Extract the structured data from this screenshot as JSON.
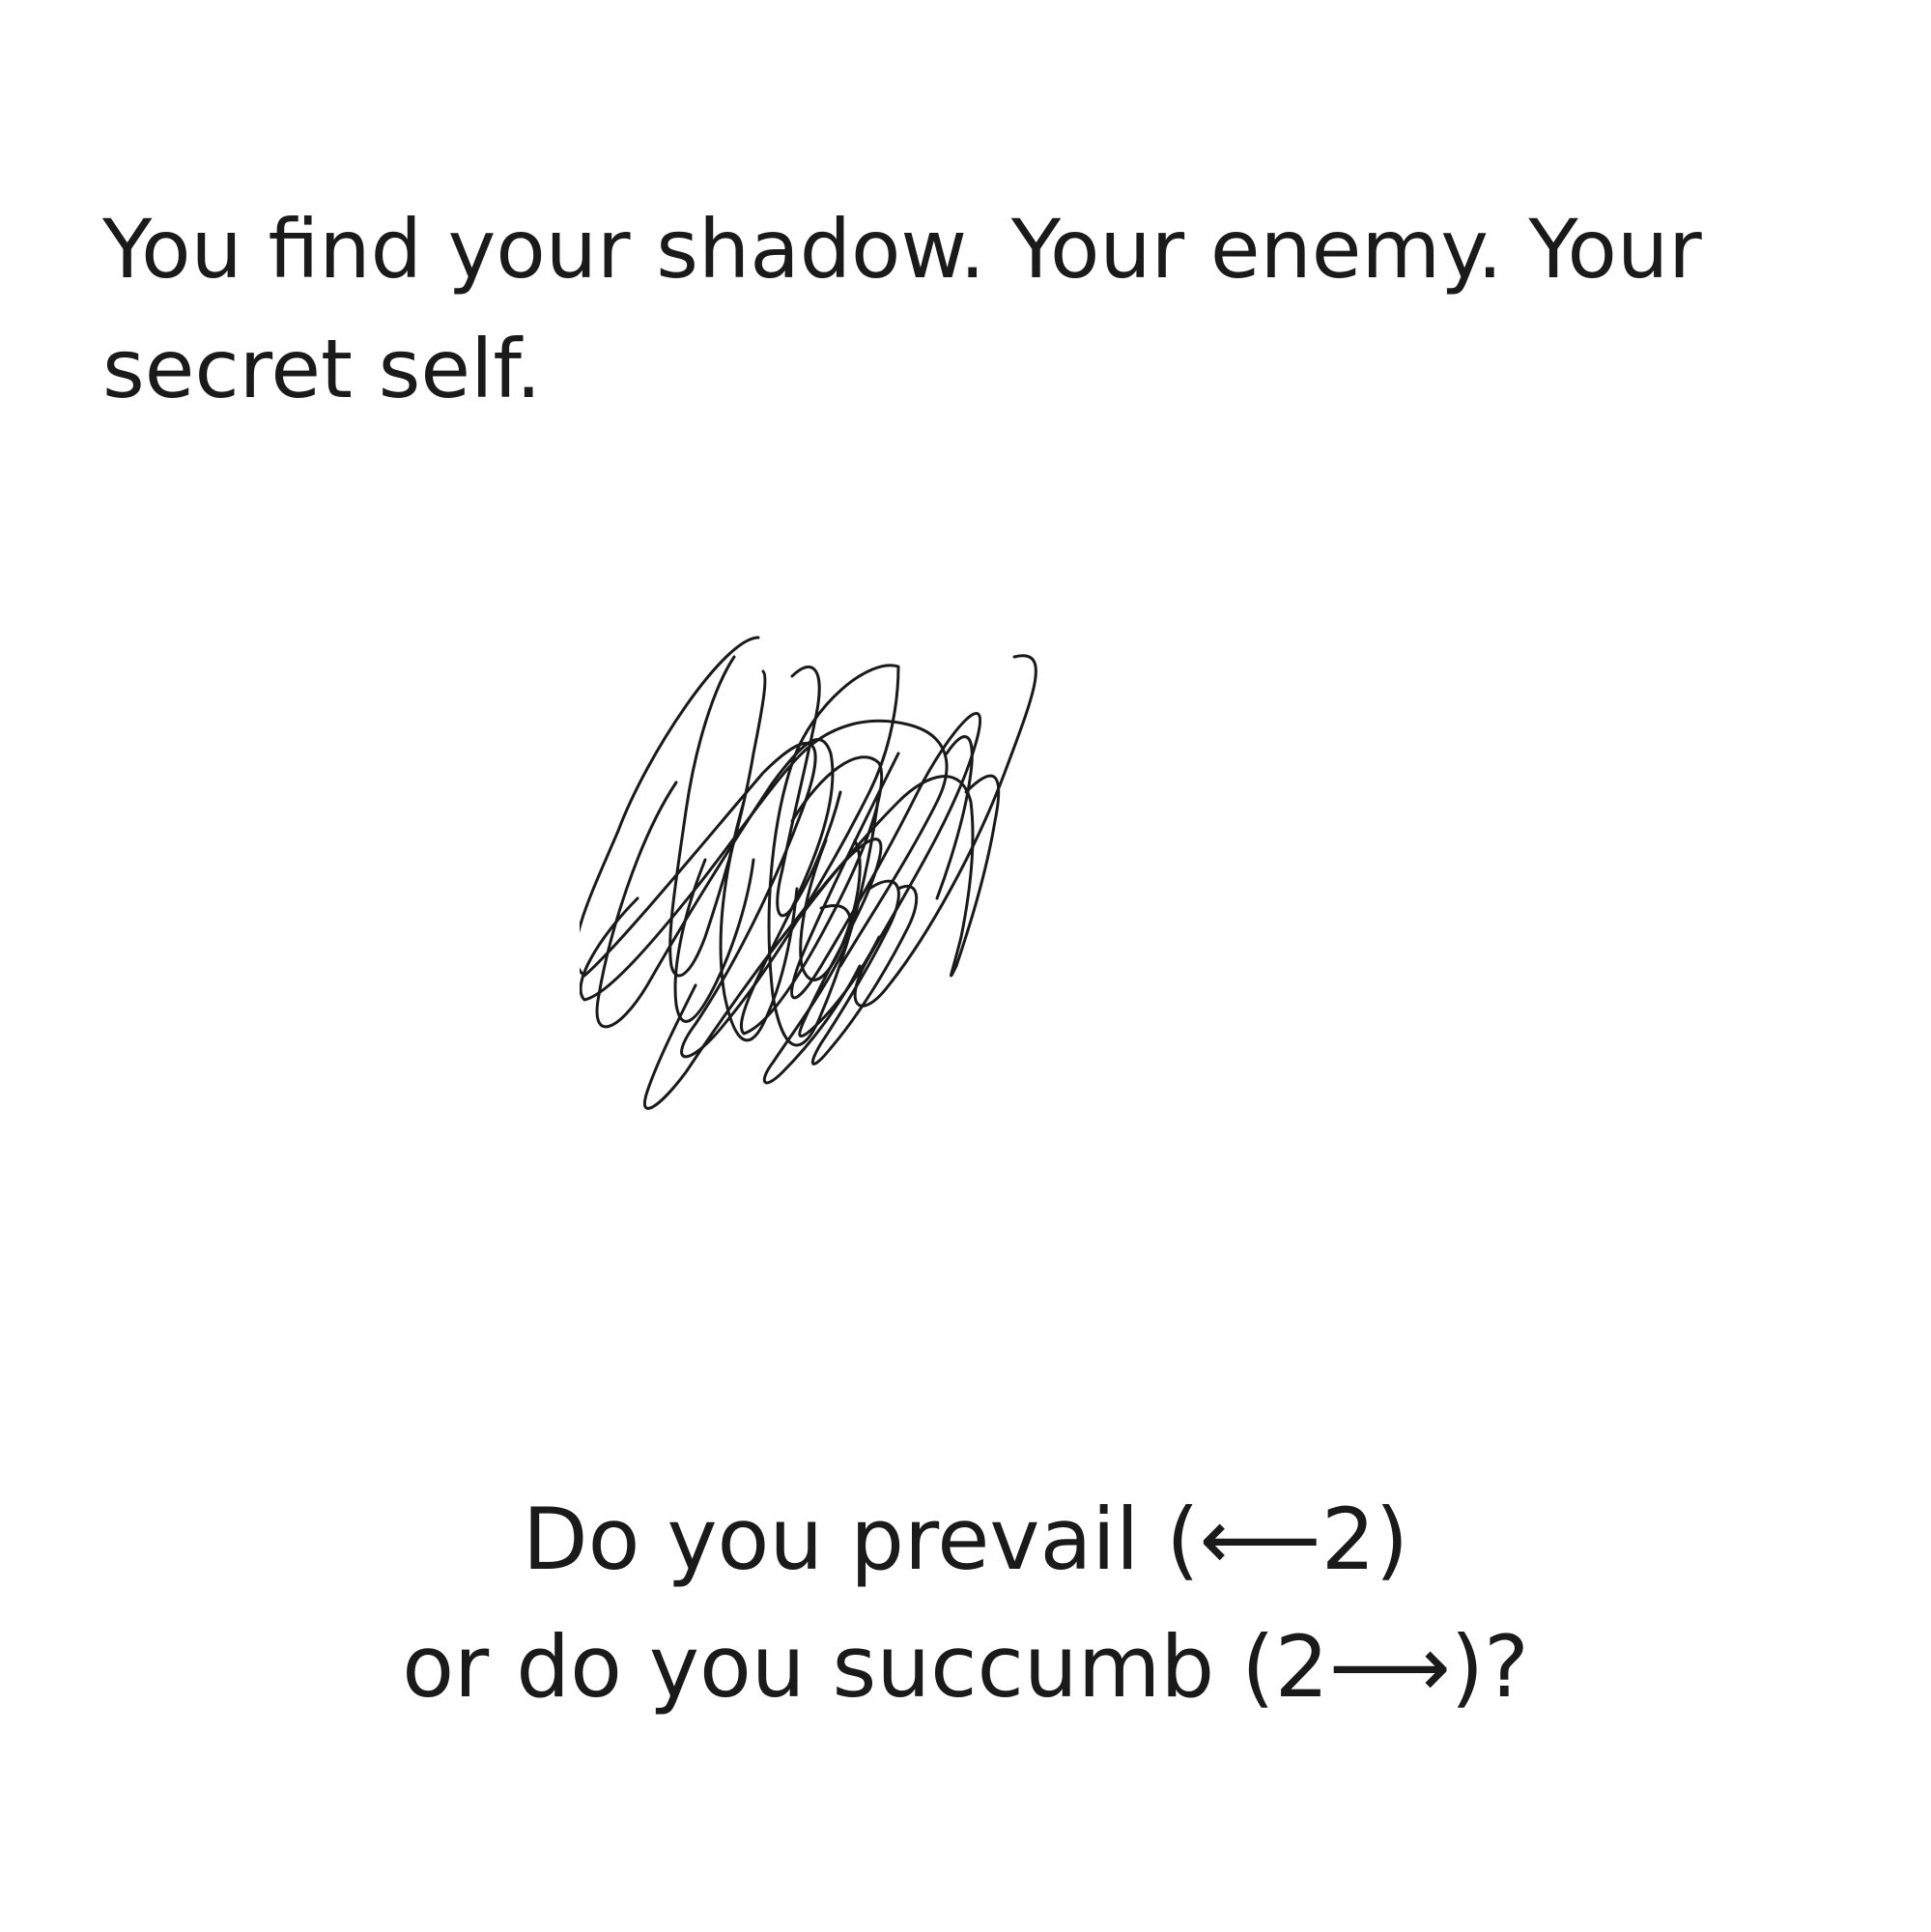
{
  "story": {
    "text": "You find your shadow. Your enemy. Your secret self."
  },
  "illustration": {
    "icon": "shadow-scribble",
    "stroke_color": "#1a1a1a"
  },
  "choices": {
    "line1": "Do you prevail (⟵2)",
    "line2": "or do you succumb (2⟶)?"
  }
}
